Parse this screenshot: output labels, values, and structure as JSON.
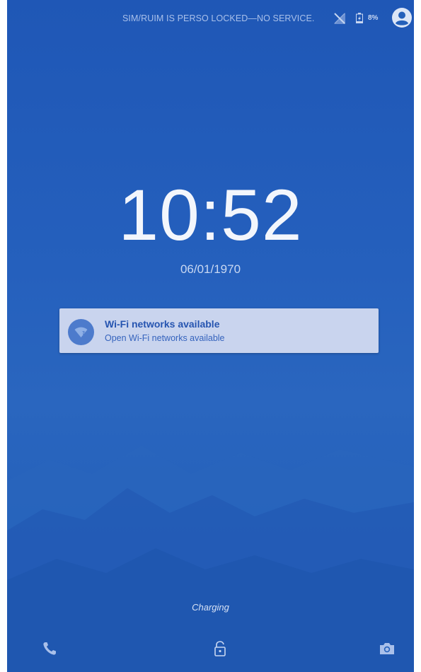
{
  "status_bar": {
    "carrier_text": "SIM/RUIM IS PERSO LOCKED—NO SERVICE.",
    "battery_percent": "8%",
    "icons": [
      "no-signal-icon",
      "battery-charging-icon",
      "user-account-icon"
    ]
  },
  "lockscreen": {
    "time": "10:52",
    "date": "06/01/1970",
    "charging_text": "Charging"
  },
  "notification": {
    "icon": "wifi-icon",
    "title": "Wi-Fi networks available",
    "text": "Open Wi-Fi networks available"
  },
  "bottom_shortcuts": {
    "left": "phone-icon",
    "center": "lock-icon",
    "right": "camera-icon"
  },
  "colors": {
    "background": "#2460ba",
    "notification_bg": "#c9d4ee",
    "notification_title": "#2554b0",
    "clock_text": "#f3f6fc"
  }
}
